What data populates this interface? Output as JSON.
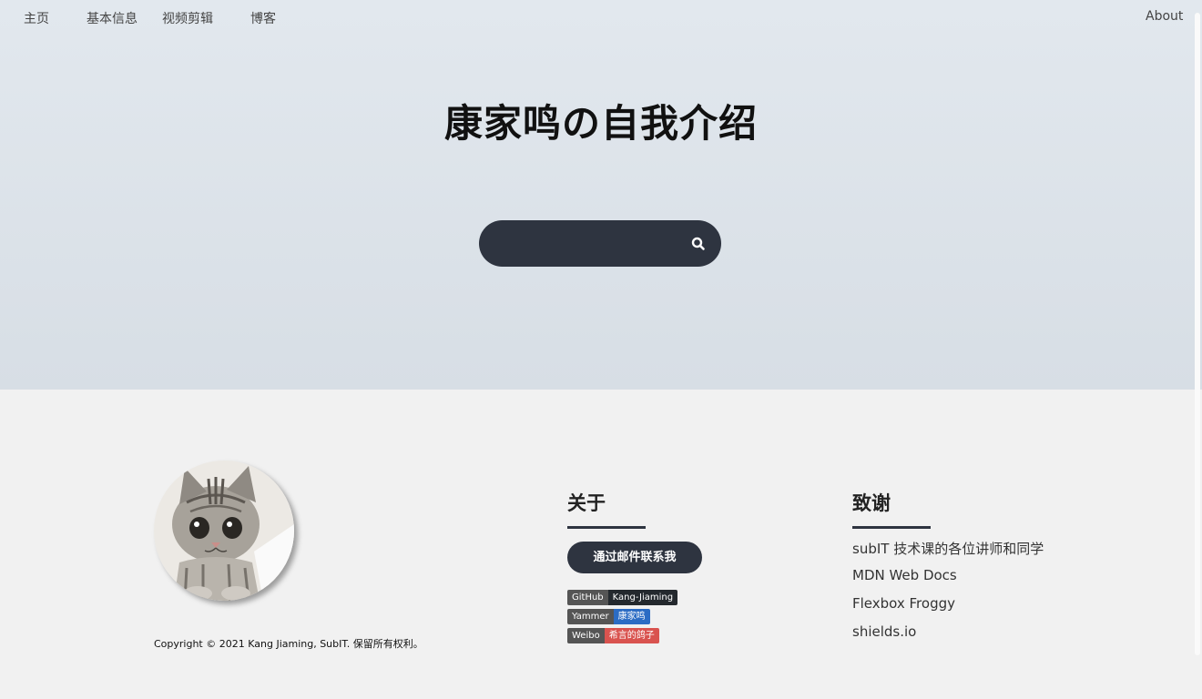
{
  "nav": {
    "items": [
      {
        "label": "主页"
      },
      {
        "label": "基本信息"
      },
      {
        "label": "视频剪辑"
      },
      {
        "label": "博客"
      }
    ],
    "about": "About"
  },
  "hero": {
    "title": "康家鸣の自我介绍",
    "search": {
      "value": "",
      "icon": "search-icon"
    }
  },
  "footer": {
    "copyright": "Copyright © 2021 Kang Jiaming, SubIT. 保留所有权利。",
    "about": {
      "title": "关于",
      "mail_button": "通过邮件联系我",
      "badges": [
        {
          "label": "GitHub",
          "value": "Kang-Jiaming",
          "color": "#24292e"
        },
        {
          "label": "Yammer",
          "value": "康家鸣",
          "color": "#2b6cc4"
        },
        {
          "label": "Weibo",
          "value": "希言的鸽子",
          "color": "#d9534f"
        }
      ]
    },
    "thanks": {
      "title": "致谢",
      "items": [
        "subIT 技术课的各位讲师和同学",
        "MDN Web Docs",
        "Flexbox Froggy",
        "shields.io"
      ]
    }
  },
  "colors": {
    "dark": "#2e3440",
    "hero_bg": "#e2e8ee",
    "page_bg": "#f1f1f1"
  }
}
